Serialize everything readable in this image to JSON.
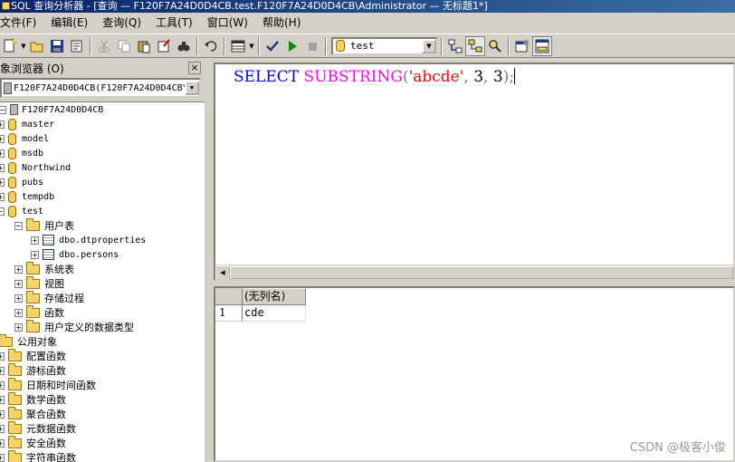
{
  "window": {
    "title": "SQL 查询分析器 - [查询 — F120F7A24D0D4CB.test.F120F7A24D0D4CB\\Administrator — 无标题1*]"
  },
  "menu": [
    "文件(F)",
    "编辑(E)",
    "查询(Q)",
    "工具(T)",
    "窗口(W)",
    "帮助(H)"
  ],
  "toolbar": {
    "database_selected": "test",
    "icons": [
      "new-query-icon",
      "open-icon",
      "save-icon",
      "load-icon",
      "cut-icon",
      "copy-icon",
      "paste-icon",
      "clear-icon",
      "find-icon",
      "undo-icon",
      "results-mode-icon",
      "check-icon",
      "execute-icon",
      "stop-icon",
      "object-browser-icon",
      "show-plan-icon",
      "index-tuning-icon",
      "properties-icon",
      "results-pane-icon"
    ]
  },
  "object_browser": {
    "title": "对象浏览器 (O)",
    "close": "×",
    "server_selector": "F120F7A24D0D4CB(F120F7A24D0D4CB\\",
    "tree": {
      "server": "F120F7A24D0D4CB",
      "databases": [
        "master",
        "model",
        "msdb",
        "Northwind",
        "pubs",
        "tempdb",
        "test"
      ],
      "test_children": {
        "user_tables": "用户表",
        "tables": [
          "dbo.dtproperties",
          "dbo.persons"
        ],
        "system_tables": "系统表",
        "views": "视图",
        "stored_procedures": "存储过程",
        "functions": "函数",
        "user_types": "用户定义的数据类型"
      },
      "common_objects": "公用对象",
      "common_children": [
        "配置函数",
        "游标函数",
        "日期和时间函数",
        "数学函数",
        "聚合函数",
        "元数据函数",
        "安全函数",
        "字符串函数"
      ]
    }
  },
  "editor": {
    "keyword": "SELECT",
    "function": "SUBSTRING",
    "open_paren": "(",
    "string_arg": "'abcde'",
    "comma1": ",",
    "arg2": "3",
    "comma2": ",",
    "arg3": "3",
    "close": ");"
  },
  "results": {
    "columns": [
      "(无列名)"
    ],
    "rows": [
      {
        "num": "1",
        "values": [
          "cde"
        ]
      }
    ]
  },
  "watermark": "CSDN @极客小俊",
  "colors": {
    "keyword": "#0000ff",
    "function": "#ff00ff",
    "string": "#ff0000",
    "title_bar": "#0a246a"
  }
}
